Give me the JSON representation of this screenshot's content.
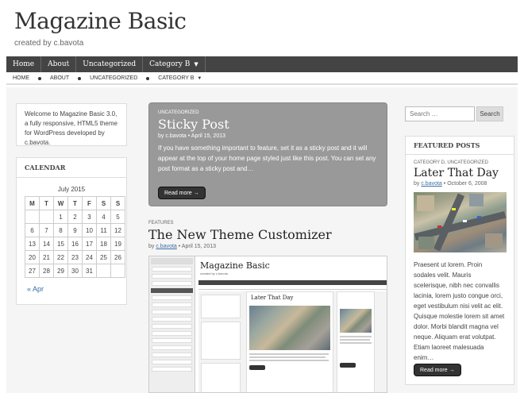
{
  "site": {
    "title": "Magazine Basic",
    "tagline": "created by c.bavota"
  },
  "nav_primary": [
    {
      "label": "Home"
    },
    {
      "label": "About"
    },
    {
      "label": "Uncategorized"
    },
    {
      "label": "Category B",
      "has_dropdown": true
    }
  ],
  "nav_secondary": [
    {
      "label": "HOME"
    },
    {
      "label": "ABOUT"
    },
    {
      "label": "UNCATEGORIZED"
    },
    {
      "label": "CATEGORY B",
      "has_dropdown": true
    }
  ],
  "icons": {
    "dropdown": "chevron-down-icon",
    "arrow": "arrow-right-icon"
  },
  "colors": {
    "nav_bg": "#444444",
    "link": "#3b6ea5",
    "sticky_bg": "#999999",
    "button_bg": "#333333"
  },
  "welcome_widget": {
    "text": "Welcome to Magazine Basic 3.0, a fully responsive, HTML5 theme for WordPress developed by c.bavota."
  },
  "calendar": {
    "title": "CALENDAR",
    "month": "July 2015",
    "days": [
      "M",
      "T",
      "W",
      "T",
      "F",
      "S",
      "S"
    ],
    "weeks": [
      [
        "",
        "",
        "1",
        "2",
        "3",
        "4",
        "5"
      ],
      [
        "6",
        "7",
        "8",
        "9",
        "10",
        "11",
        "12"
      ],
      [
        "13",
        "14",
        "15",
        "16",
        "17",
        "18",
        "19"
      ],
      [
        "20",
        "21",
        "22",
        "23",
        "24",
        "25",
        "26"
      ],
      [
        "27",
        "28",
        "29",
        "30",
        "31",
        "",
        ""
      ]
    ],
    "prev_link": "« Apr"
  },
  "sticky_post": {
    "category": "UNCATEGORIZED",
    "title": "Sticky Post",
    "meta_by": "by",
    "author": "c.bavota",
    "date": "April 15, 2013",
    "excerpt": "If you have something important to feature, set it as a sticky post and it will appear at the top of your home page styled just like this post. You can set any post format as a sticky post and…",
    "button": "Read more →"
  },
  "post2": {
    "category": "FEATURES",
    "title": "The New Theme Customizer",
    "meta_by": "by",
    "author": "c.bavota",
    "date": "April 15, 2013",
    "screenshot_title": "Magazine Basic",
    "screenshot_featured_title": "Later That Day"
  },
  "search": {
    "placeholder": "Search …",
    "button": "Search"
  },
  "featured_posts": {
    "widget_title": "FEATURED POSTS",
    "category": "CATEGORY D, UNCATEGORIZED",
    "title": "Later That Day",
    "meta_by": "by",
    "author": "c.bavota",
    "date": "October 6, 2008",
    "excerpt": "Praesent ut lorem. Proin sodales velit. Mauris scelerisque, nibh nec convallis lacinia, lorem justo congue orci, eget vestibulum nisi velit ac elit. Quisque molestie lorem sit amet dolor. Morbi blandit magna vel neque. Aliquam erat volutpat. Etiam laoreet malesuada enim…",
    "button": "Read more →"
  }
}
